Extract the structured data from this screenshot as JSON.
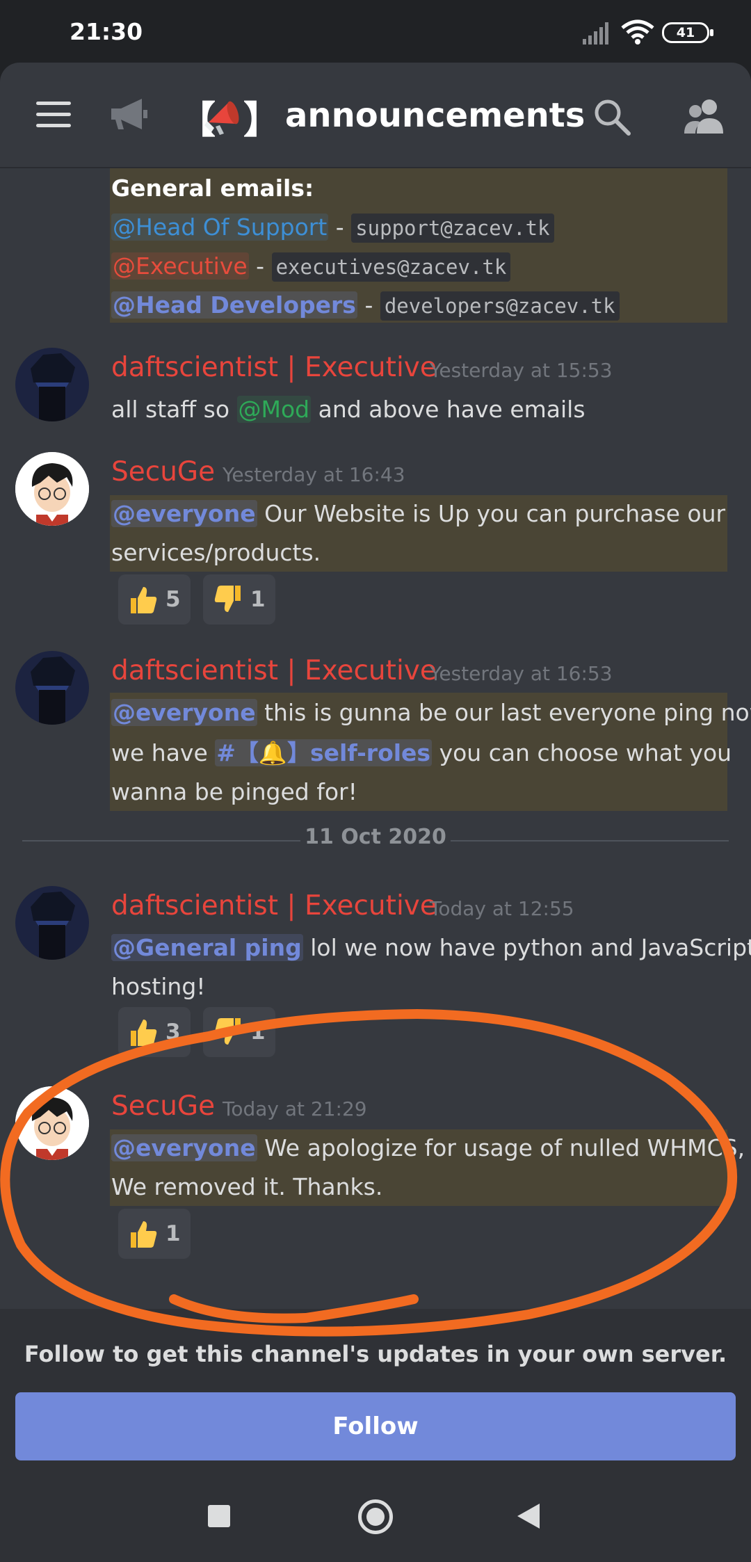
{
  "status_bar": {
    "time": "21:30",
    "battery": "41"
  },
  "header": {
    "channel_name": "announcements",
    "channel_prefix_left": "【",
    "channel_prefix_right": "】"
  },
  "messages": {
    "top": {
      "title": "General emails:",
      "rows": [
        {
          "mention": "@Head Of Support",
          "sep": " - ",
          "email": "support@zacev.tk"
        },
        {
          "mention": "@Executive",
          "sep": " - ",
          "email": "executives@zacev.tk"
        },
        {
          "mention": "@Head Developers",
          "sep": " - ",
          "email": "developers@zacev.tk"
        }
      ]
    },
    "m1": {
      "author": "daftscientist | Executive",
      "time": "Yesterday at 15:53",
      "pre": "all staff so ",
      "mention": "@Mod",
      "post": " and above have emails"
    },
    "m2": {
      "author": "SecuGe",
      "time": "Yesterday at 16:43",
      "mention": "@everyone",
      "line1": " Our Website is Up you can purchase our",
      "line2": "services/products.",
      "reactions": [
        {
          "emoji": "thumbs-up",
          "count": "5"
        },
        {
          "emoji": "thumbs-down",
          "count": "1"
        }
      ]
    },
    "m3": {
      "author": "daftscientist | Executive",
      "time": "Yesterday at 16:53",
      "mention": "@everyone",
      "line1": " this is gunna be our last everyone ping now",
      "line2_pre": "we have ",
      "channel_mention": "#【🔔】self-roles",
      "line2_post": " you can choose what you",
      "line3": "wanna be pinged for!"
    },
    "date_divider": "11 Oct 2020",
    "m4": {
      "author": "daftscientist | Executive",
      "time": "Today at 12:55",
      "mention": "@General ping",
      "line1": " lol we now have python and JavaScript",
      "line2": "hosting!",
      "reactions": [
        {
          "emoji": "thumbs-up",
          "count": "3"
        },
        {
          "emoji": "thumbs-down",
          "count": "1"
        }
      ]
    },
    "m5": {
      "author": "SecuGe",
      "time": "Today at 21:29",
      "mention": "@everyone",
      "line1": " We apologize for usage of nulled WHMCS,",
      "line2": "We removed it. Thanks.",
      "reactions": [
        {
          "emoji": "thumbs-up",
          "count": "1"
        }
      ]
    }
  },
  "follow": {
    "prompt": "Follow to get this channel's updates in your own server.",
    "button": "Follow"
  },
  "colors": {
    "accent": "#7289da",
    "author_red": "#e8453c",
    "annotation": "#f26b21"
  }
}
